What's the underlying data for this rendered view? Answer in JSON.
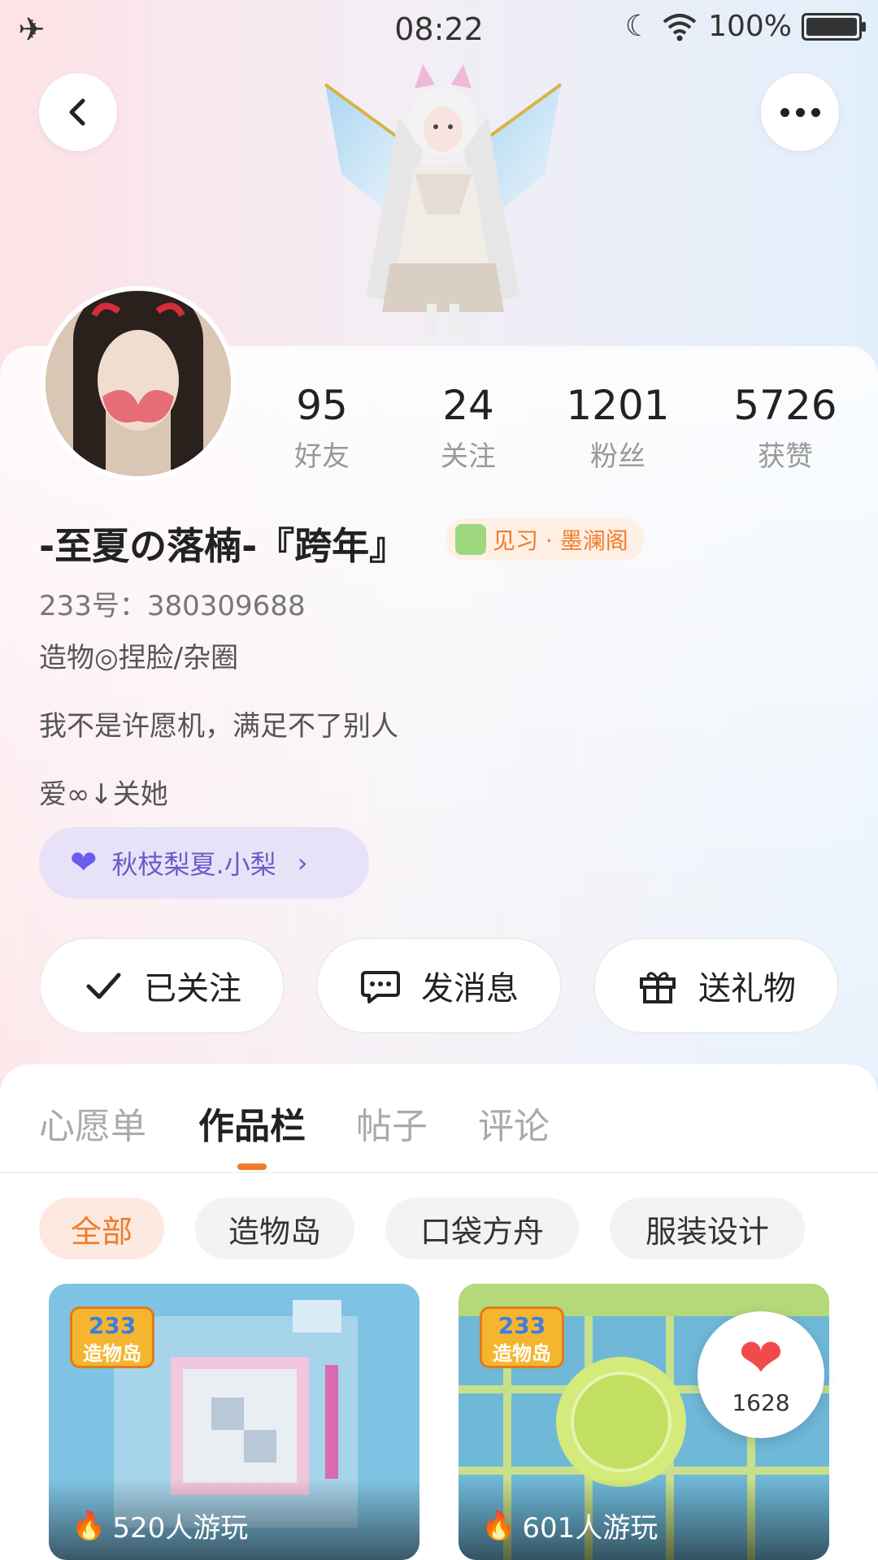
{
  "status": {
    "time": "08:22",
    "battery": "100%"
  },
  "profile": {
    "stats": [
      {
        "num": "95",
        "label": "好友"
      },
      {
        "num": "24",
        "label": "关注"
      },
      {
        "num": "1201",
        "label": "粉丝"
      },
      {
        "num": "5726",
        "label": "获赞"
      }
    ],
    "username": "-至夏の落楠-『跨年』",
    "badge": "见习 · 墨澜阁",
    "uid": "233号：380309688",
    "tagline": "造物◎捏脸/杂圈",
    "bio_line1": "我不是许愿机，满足不了别人",
    "bio_line2": "爱∞↓关她",
    "cp_name": "秋枝梨夏.小梨"
  },
  "actions": {
    "follow": "已关注",
    "message": "发消息",
    "gift": "送礼物"
  },
  "tabs": [
    "心愿单",
    "作品栏",
    "帖子",
    "评论"
  ],
  "filters": [
    "全部",
    "造物岛",
    "口袋方舟",
    "服装设计"
  ],
  "games": [
    {
      "logo_top": "233",
      "logo_bottom": "造物岛",
      "plays": "520人游玩"
    },
    {
      "logo_top": "233",
      "logo_bottom": "造物岛",
      "plays": "601人游玩"
    }
  ],
  "like_bubble": {
    "count": "1628"
  },
  "colors": {
    "accent": "#f07b2a",
    "cp_purple": "#6b5cf0"
  }
}
